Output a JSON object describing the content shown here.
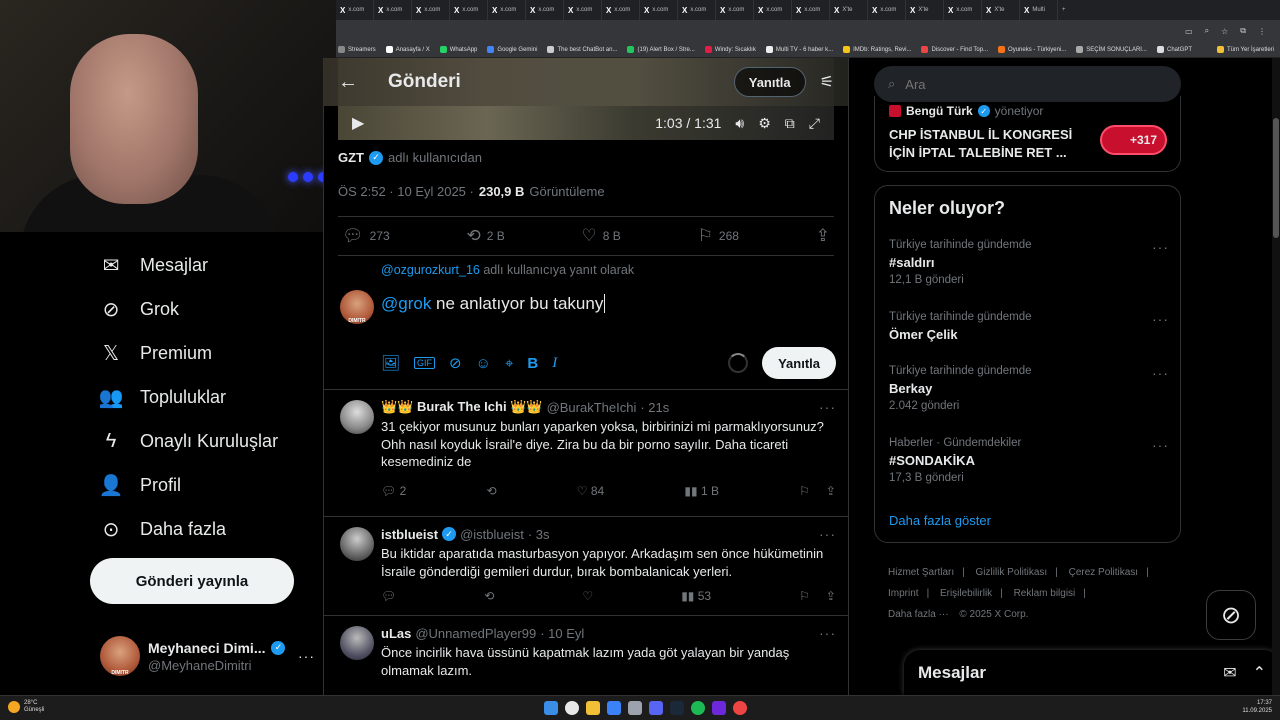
{
  "browser": {
    "tabs": [
      "x.com",
      "x.com",
      "x.com",
      "x.com",
      "x.com",
      "x.com",
      "x.com",
      "x.com",
      "x.com",
      "x.com",
      "x.com",
      "x.com",
      "x.com",
      "X'te",
      "x.com",
      "X'te",
      "x.com",
      "X'te",
      "Multi"
    ],
    "bookmarks": [
      "Streamers",
      "Anasayfa / X",
      "WhatsApp",
      "Google Gemini",
      "The best ChatBot an...",
      "(19) Alert Box / Stre...",
      "Windy: Sıcaklık",
      "Multi TV - 6 haber k...",
      "IMDb: Ratings, Revi...",
      "Discover - Find Top...",
      "Oyuneks - Türkiyeni...",
      "SEÇİM SONUÇLARI...",
      "ChatGPT"
    ],
    "all_bookmarks": "Tüm Yer İşaretleri"
  },
  "nav": {
    "items": [
      {
        "label": "Mesajlar",
        "icon": "mail-icon",
        "glyph": "✉"
      },
      {
        "label": "Grok",
        "icon": "grok-icon",
        "glyph": "⊘"
      },
      {
        "label": "Premium",
        "icon": "x-logo-icon",
        "glyph": "𝕏"
      },
      {
        "label": "Topluluklar",
        "icon": "communities-icon",
        "glyph": "👥"
      },
      {
        "label": "Onaylı Kuruluşlar",
        "icon": "lightning-icon",
        "glyph": "ϟ"
      },
      {
        "label": "Profil",
        "icon": "profile-icon",
        "glyph": "👤"
      },
      {
        "label": "Daha fazla",
        "icon": "more-circle-icon",
        "glyph": "⊙"
      }
    ],
    "post_button": "Gönderi yayınla",
    "account": {
      "name": "Meyhaneci Dimi...",
      "handle": "@MeyhaneDimitri"
    }
  },
  "header": {
    "title": "Gönderi",
    "reply_button": "Yanıtla"
  },
  "video": {
    "time": "1:03 / 1:31"
  },
  "post": {
    "author": "GZT",
    "author_suffix": "adlı kullanıcıdan",
    "time": "ÖS 2:52 · 10 Eyl 2025 ·",
    "views": "230,9 B",
    "views_label": "Görüntüleme",
    "replies": "273",
    "reposts": "2 B",
    "likes": "8 B",
    "bookmarks": "268"
  },
  "compose": {
    "reply_to_handle": "@ozgurozkurt_16",
    "reply_to_suffix": "adlı kullanıcıya yanıt olarak",
    "mention": "@grok",
    "text": " ne anlatıyor bu takuny",
    "reply_button": "Yanıtla"
  },
  "replies": [
    {
      "name": "👑👑 Burak The Ichi 👑👑",
      "handle": "@BurakTheIchi",
      "time": "· 21s",
      "text": "31 çekiyor musunuz bunları yaparken yoksa, birbirinizi mi parmaklıyorsunuz? Ohh nasıl koyduk İsrail'e diye. Zira bu da bir porno sayılır. Daha ticareti kesemediniz de",
      "replies": "2",
      "reposts": "",
      "likes": "84",
      "views": "1 B"
    },
    {
      "name": "istblueist",
      "handle": "@istblueist",
      "time": "· 3s",
      "text": "Bu iktidar aparatıda masturbasyon yapıyor. Arkadaşım sen önce hükümetinin İsraile gönderdiği gemileri durdur, bırak bombalanicak yerleri.",
      "replies": "",
      "reposts": "",
      "likes": "",
      "views": "53"
    },
    {
      "name": "uLas",
      "handle": "@UnnamedPlayer99",
      "time": "· 10 Eyl",
      "text": "Önce incirlik hava üssünü kapatmak lazım yada göt yalayan bir yandaş olmamak lazım."
    }
  ],
  "search": {
    "placeholder": "Ara"
  },
  "top_trend": {
    "source": "Bengü Türk",
    "role": "yönetiyor",
    "headline": "CHP İSTANBUL İL KONGRESİ İÇİN İPTAL TALEBİNE RET ...",
    "badge": "+317"
  },
  "happening": {
    "title": "Neler oluyor?",
    "trends": [
      {
        "context": "Türkiye tarihinde gündemde",
        "name": "#saldırı",
        "count": "12,1 B gönderi"
      },
      {
        "context": "Türkiye tarihinde gündemde",
        "name": "Ömer Çelik",
        "count": ""
      },
      {
        "context": "Türkiye tarihinde gündemde",
        "name": "Berkay",
        "count": "2.042 gönderi"
      },
      {
        "context": "Haberler · Gündemdekiler",
        "name": "#SONDAKİKA",
        "count": "17,3 B gönderi"
      }
    ],
    "show_more": "Daha fazla göster"
  },
  "footer": {
    "links": [
      "Hizmet Şartları",
      "Gizlilik Politikası",
      "Çerez Politikası",
      "Imprint",
      "Erişilebilirlik",
      "Reklam bilgisi",
      "Daha fazla ···"
    ],
    "copyright": "© 2025 X Corp."
  },
  "messages_drawer": {
    "title": "Mesajlar"
  },
  "taskbar": {
    "weather_temp": "28°C",
    "weather_desc": "Güneşli",
    "time": "17:37",
    "date": "11.09.2025"
  },
  "colors": {
    "accent": "#1d9bf0",
    "background": "#000000",
    "border": "#2f3336",
    "muted": "#71767b"
  }
}
